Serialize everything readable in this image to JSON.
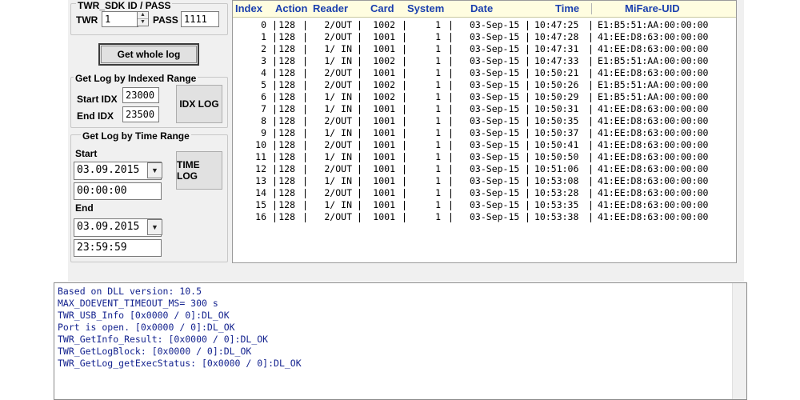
{
  "sdk_group": {
    "title": "TWR_SDK ID / PASS",
    "twr_label": "TWR",
    "twr_value": "1",
    "pass_label": "PASS",
    "pass_value": "1111"
  },
  "whole_log": {
    "label": "Get whole log"
  },
  "index_range": {
    "title": "Get Log by Indexed Range",
    "start_label": "Start IDX",
    "start_value": "23000",
    "end_label": "End IDX",
    "end_value": "23500",
    "button": "IDX LOG"
  },
  "time_range": {
    "title": "Get Log by Time Range",
    "start_label": "Start",
    "start_date": "03.09.2015",
    "start_time": "00:00:00",
    "end_label": "End",
    "end_date": "03.09.2015",
    "end_time": "23:59:59",
    "button": "TIME LOG"
  },
  "table": {
    "columns": [
      "Index",
      "Action",
      "Reader",
      "Card",
      "System",
      "Date",
      "Time",
      "MiFare-UID"
    ],
    "rows": [
      {
        "index": "0",
        "action": "128",
        "reader": "2/OUT",
        "card": "1002",
        "system": "1",
        "date": "03-Sep-15",
        "time": "10:47:25",
        "uid": "E1:B5:51:AA:00:00:00"
      },
      {
        "index": "1",
        "action": "128",
        "reader": "2/OUT",
        "card": "1001",
        "system": "1",
        "date": "03-Sep-15",
        "time": "10:47:28",
        "uid": "41:EE:D8:63:00:00:00"
      },
      {
        "index": "2",
        "action": "128",
        "reader": "1/ IN",
        "card": "1001",
        "system": "1",
        "date": "03-Sep-15",
        "time": "10:47:31",
        "uid": "41:EE:D8:63:00:00:00"
      },
      {
        "index": "3",
        "action": "128",
        "reader": "1/ IN",
        "card": "1002",
        "system": "1",
        "date": "03-Sep-15",
        "time": "10:47:33",
        "uid": "E1:B5:51:AA:00:00:00"
      },
      {
        "index": "4",
        "action": "128",
        "reader": "2/OUT",
        "card": "1001",
        "system": "1",
        "date": "03-Sep-15",
        "time": "10:50:21",
        "uid": "41:EE:D8:63:00:00:00"
      },
      {
        "index": "5",
        "action": "128",
        "reader": "2/OUT",
        "card": "1002",
        "system": "1",
        "date": "03-Sep-15",
        "time": "10:50:26",
        "uid": "E1:B5:51:AA:00:00:00"
      },
      {
        "index": "6",
        "action": "128",
        "reader": "1/ IN",
        "card": "1002",
        "system": "1",
        "date": "03-Sep-15",
        "time": "10:50:29",
        "uid": "E1:B5:51:AA:00:00:00"
      },
      {
        "index": "7",
        "action": "128",
        "reader": "1/ IN",
        "card": "1001",
        "system": "1",
        "date": "03-Sep-15",
        "time": "10:50:31",
        "uid": "41:EE:D8:63:00:00:00"
      },
      {
        "index": "8",
        "action": "128",
        "reader": "2/OUT",
        "card": "1001",
        "system": "1",
        "date": "03-Sep-15",
        "time": "10:50:35",
        "uid": "41:EE:D8:63:00:00:00"
      },
      {
        "index": "9",
        "action": "128",
        "reader": "1/ IN",
        "card": "1001",
        "system": "1",
        "date": "03-Sep-15",
        "time": "10:50:37",
        "uid": "41:EE:D8:63:00:00:00"
      },
      {
        "index": "10",
        "action": "128",
        "reader": "2/OUT",
        "card": "1001",
        "system": "1",
        "date": "03-Sep-15",
        "time": "10:50:41",
        "uid": "41:EE:D8:63:00:00:00"
      },
      {
        "index": "11",
        "action": "128",
        "reader": "1/ IN",
        "card": "1001",
        "system": "1",
        "date": "03-Sep-15",
        "time": "10:50:50",
        "uid": "41:EE:D8:63:00:00:00"
      },
      {
        "index": "12",
        "action": "128",
        "reader": "2/OUT",
        "card": "1001",
        "system": "1",
        "date": "03-Sep-15",
        "time": "10:51:06",
        "uid": "41:EE:D8:63:00:00:00"
      },
      {
        "index": "13",
        "action": "128",
        "reader": "1/ IN",
        "card": "1001",
        "system": "1",
        "date": "03-Sep-15",
        "time": "10:53:08",
        "uid": "41:EE:D8:63:00:00:00"
      },
      {
        "index": "14",
        "action": "128",
        "reader": "2/OUT",
        "card": "1001",
        "system": "1",
        "date": "03-Sep-15",
        "time": "10:53:28",
        "uid": "41:EE:D8:63:00:00:00"
      },
      {
        "index": "15",
        "action": "128",
        "reader": "1/ IN",
        "card": "1001",
        "system": "1",
        "date": "03-Sep-15",
        "time": "10:53:35",
        "uid": "41:EE:D8:63:00:00:00"
      },
      {
        "index": "16",
        "action": "128",
        "reader": "2/OUT",
        "card": "1001",
        "system": "1",
        "date": "03-Sep-15",
        "time": "10:53:38",
        "uid": "41:EE:D8:63:00:00:00"
      }
    ]
  },
  "log": {
    "lines": [
      "Based on DLL version: 10.5",
      "MAX_DOEVENT_TIMEOUT_MS= 300 s",
      "TWR_USB_Info [0x0000 / 0]:DL_OK",
      "Port is open. [0x0000 / 0]:DL_OK",
      "TWR_GetInfo_Result: [0x0000 / 0]:DL_OK",
      "TWR_GetLogBlock: [0x0000 / 0]:DL_OK",
      "TWR_GetLog_getExecStatus: [0x0000 / 0]:DL_OK"
    ]
  },
  "icons": {
    "spin": "spin-arrows-icon",
    "dropdown": "chevron-down-icon"
  }
}
